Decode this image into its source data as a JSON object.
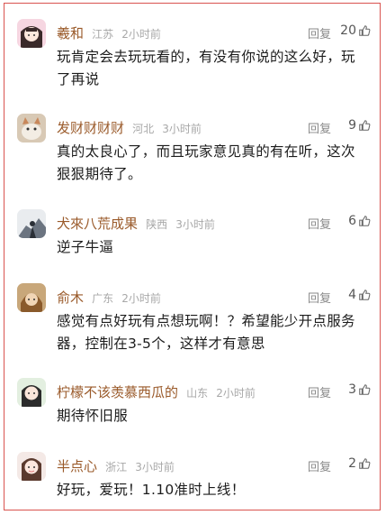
{
  "comments": [
    {
      "name": "羲和",
      "location": "江苏",
      "time": "2小时前",
      "reply": "回复",
      "likes": "20",
      "text": "玩肯定会去玩玩看的，有没有你说的这么好，玩了再说"
    },
    {
      "name": "发财财财财",
      "location": "河北",
      "time": "3小时前",
      "reply": "回复",
      "likes": "9",
      "text": "真的太良心了，而且玩家意见真的有在听，这次狠狠期待了。"
    },
    {
      "name": "犬來八荒成果",
      "location": "陕西",
      "time": "3小时前",
      "reply": "回复",
      "likes": "6",
      "text": "逆子牛逼"
    },
    {
      "name": "俞木",
      "location": "广东",
      "time": "2小时前",
      "reply": "回复",
      "likes": "4",
      "text": "感觉有点好玩有点想玩啊！？希望能少开点服务器，控制在3-5个，这样才有意思"
    },
    {
      "name": "柠檬不该羡慕西瓜的",
      "location": "山东",
      "time": "2小时前",
      "reply": "回复",
      "likes": "3",
      "text": "期待怀旧服"
    },
    {
      "name": "半点心",
      "location": "浙江",
      "time": "3小时前",
      "reply": "回复",
      "likes": "2",
      "text": "好玩，爱玩！1.10准时上线！"
    }
  ],
  "icons": {
    "like": "thumb-up-icon"
  },
  "colors": {
    "name": "#9a5a2a",
    "meta": "#a8a8a8",
    "border": "#d9534f"
  }
}
